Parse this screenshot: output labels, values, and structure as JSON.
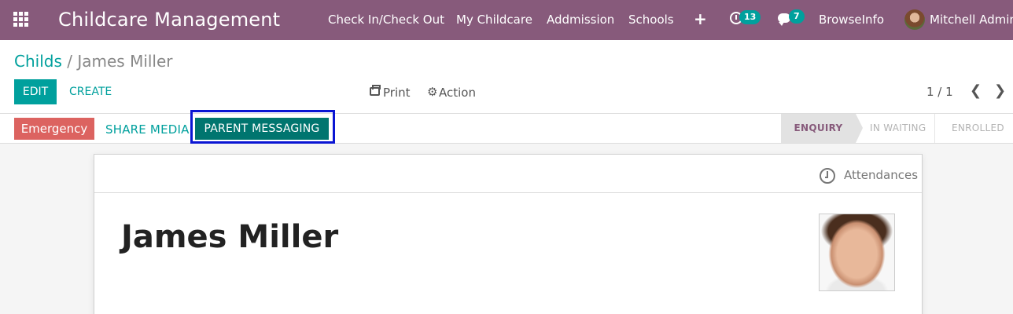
{
  "navbar": {
    "brand": "Childcare Management",
    "menu": [
      {
        "label": "Check In/Check Out"
      },
      {
        "label": "My Childcare"
      },
      {
        "label": "Addmission"
      },
      {
        "label": "Schools"
      }
    ],
    "activity_count": "13",
    "message_count": "7",
    "company": "BrowseInfo",
    "user": "Mitchell Admin",
    "colors": {
      "bar": "#875a7b",
      "badge": "#00a09d"
    }
  },
  "breadcrumb": {
    "parent": "Childs",
    "separator": "/",
    "current": "James Miller"
  },
  "toolbar": {
    "edit_label": "EDIT",
    "create_label": "CREATE",
    "print_label": "Print",
    "action_label": "Action",
    "pager": "1 / 1"
  },
  "statusbar": {
    "emergency_label": "Emergency",
    "share_media_label": "SHARE MEDIA",
    "parent_messaging_label": "PARENT MESSAGING",
    "stages": [
      {
        "label": "ENQUIRY",
        "active": true
      },
      {
        "label": "IN WAITING",
        "active": false
      },
      {
        "label": "ENROLLED",
        "active": false
      }
    ],
    "colors": {
      "emergency": "#d9534f",
      "highlight": "#0a15d3",
      "primary": "#00756f"
    }
  },
  "form": {
    "attendances_label": "Attendances",
    "name": "James Miller"
  }
}
